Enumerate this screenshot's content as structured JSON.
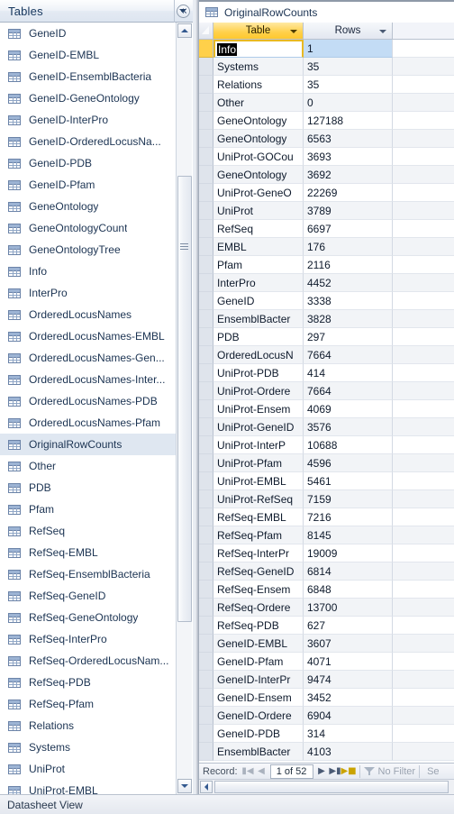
{
  "nav_pane": {
    "title": "Tables",
    "menu_icon": "chevron-down-circle-icon",
    "collapse_icon": "double-chevron-left-icon",
    "items": [
      {
        "label": "GeneID",
        "selected": false
      },
      {
        "label": "GeneID-EMBL",
        "selected": false
      },
      {
        "label": "GeneID-EnsemblBacteria",
        "selected": false
      },
      {
        "label": "GeneID-GeneOntology",
        "selected": false
      },
      {
        "label": "GeneID-InterPro",
        "selected": false
      },
      {
        "label": "GeneID-OrderedLocusNa...",
        "selected": false
      },
      {
        "label": "GeneID-PDB",
        "selected": false
      },
      {
        "label": "GeneID-Pfam",
        "selected": false
      },
      {
        "label": "GeneOntology",
        "selected": false
      },
      {
        "label": "GeneOntologyCount",
        "selected": false
      },
      {
        "label": "GeneOntologyTree",
        "selected": false
      },
      {
        "label": "Info",
        "selected": false
      },
      {
        "label": "InterPro",
        "selected": false
      },
      {
        "label": "OrderedLocusNames",
        "selected": false
      },
      {
        "label": "OrderedLocusNames-EMBL",
        "selected": false
      },
      {
        "label": "OrderedLocusNames-Gen...",
        "selected": false
      },
      {
        "label": "OrderedLocusNames-Inter...",
        "selected": false
      },
      {
        "label": "OrderedLocusNames-PDB",
        "selected": false
      },
      {
        "label": "OrderedLocusNames-Pfam",
        "selected": false
      },
      {
        "label": "OriginalRowCounts",
        "selected": true
      },
      {
        "label": "Other",
        "selected": false
      },
      {
        "label": "PDB",
        "selected": false
      },
      {
        "label": "Pfam",
        "selected": false
      },
      {
        "label": "RefSeq",
        "selected": false
      },
      {
        "label": "RefSeq-EMBL",
        "selected": false
      },
      {
        "label": "RefSeq-EnsemblBacteria",
        "selected": false
      },
      {
        "label": "RefSeq-GeneID",
        "selected": false
      },
      {
        "label": "RefSeq-GeneOntology",
        "selected": false
      },
      {
        "label": "RefSeq-InterPro",
        "selected": false
      },
      {
        "label": "RefSeq-OrderedLocusNam...",
        "selected": false
      },
      {
        "label": "RefSeq-PDB",
        "selected": false
      },
      {
        "label": "RefSeq-Pfam",
        "selected": false
      },
      {
        "label": "Relations",
        "selected": false
      },
      {
        "label": "Systems",
        "selected": false
      },
      {
        "label": "UniProt",
        "selected": false
      },
      {
        "label": "UniProt-EMBL",
        "selected": false
      }
    ]
  },
  "document": {
    "tab_label": "OriginalRowCounts",
    "tab_icon": "table-icon"
  },
  "grid": {
    "columns": [
      {
        "label": "Table",
        "active": true,
        "width": 100,
        "dropdown_icon": "chevron-down-icon"
      },
      {
        "label": "Rows",
        "active": false,
        "width": 100,
        "dropdown_icon": "chevron-down-icon"
      }
    ],
    "editing_cell": {
      "row": 0,
      "column": 0,
      "value": "Info",
      "selected_text": true
    },
    "rows": [
      {
        "table": "Info",
        "rows": "1"
      },
      {
        "table": "Systems",
        "rows": "35"
      },
      {
        "table": "Relations",
        "rows": "35"
      },
      {
        "table": "Other",
        "rows": "0"
      },
      {
        "table": "GeneOntology",
        "rows": "127188"
      },
      {
        "table": "GeneOntology",
        "rows": "6563"
      },
      {
        "table": "UniProt-GOCou",
        "rows": "3693"
      },
      {
        "table": "GeneOntology",
        "rows": "3692"
      },
      {
        "table": "UniProt-GeneO",
        "rows": "22269"
      },
      {
        "table": "UniProt",
        "rows": "3789"
      },
      {
        "table": "RefSeq",
        "rows": "6697"
      },
      {
        "table": "EMBL",
        "rows": "176"
      },
      {
        "table": "Pfam",
        "rows": "2116"
      },
      {
        "table": "InterPro",
        "rows": "4452"
      },
      {
        "table": "GeneID",
        "rows": "3338"
      },
      {
        "table": "EnsemblBacter",
        "rows": "3828"
      },
      {
        "table": "PDB",
        "rows": "297"
      },
      {
        "table": "OrderedLocusN",
        "rows": "7664"
      },
      {
        "table": "UniProt-PDB",
        "rows": "414"
      },
      {
        "table": "UniProt-Ordere",
        "rows": "7664"
      },
      {
        "table": "UniProt-Ensem",
        "rows": "4069"
      },
      {
        "table": "UniProt-GeneID",
        "rows": "3576"
      },
      {
        "table": "UniProt-InterP",
        "rows": "10688"
      },
      {
        "table": "UniProt-Pfam",
        "rows": "4596"
      },
      {
        "table": "UniProt-EMBL",
        "rows": "5461"
      },
      {
        "table": "UniProt-RefSeq",
        "rows": "7159"
      },
      {
        "table": "RefSeq-EMBL",
        "rows": "7216"
      },
      {
        "table": "RefSeq-Pfam",
        "rows": "8145"
      },
      {
        "table": "RefSeq-InterPr",
        "rows": "19009"
      },
      {
        "table": "RefSeq-GeneID",
        "rows": "6814"
      },
      {
        "table": "RefSeq-Ensem",
        "rows": "6848"
      },
      {
        "table": "RefSeq-Ordere",
        "rows": "13700"
      },
      {
        "table": "RefSeq-PDB",
        "rows": "627"
      },
      {
        "table": "GeneID-EMBL",
        "rows": "3607"
      },
      {
        "table": "GeneID-Pfam",
        "rows": "4071"
      },
      {
        "table": "GeneID-InterPr",
        "rows": "9474"
      },
      {
        "table": "GeneID-Ensem",
        "rows": "3452"
      },
      {
        "table": "GeneID-Ordere",
        "rows": "6904"
      },
      {
        "table": "GeneID-PDB",
        "rows": "314"
      },
      {
        "table": "EnsemblBacter",
        "rows": "4103"
      }
    ]
  },
  "record_nav": {
    "label": "Record:",
    "first_icon": "first-record-icon",
    "prev_icon": "previous-record-icon",
    "position": "1 of 52",
    "next_icon": "next-record-icon",
    "last_icon": "last-record-icon",
    "new_icon": "new-record-icon",
    "filter_icon": "funnel-icon",
    "filter_label": "No Filter",
    "search_label": "Se"
  },
  "scrollbars": {
    "nav_up_icon": "triangle-up-icon",
    "nav_down_icon": "triangle-down-icon",
    "h_left_icon": "triangle-left-icon"
  },
  "status_bar": {
    "text": "Datasheet View"
  },
  "colors": {
    "accent_gold": "#ffd04a",
    "selection_blue": "#c3dcf5",
    "nav_title": "#17375e",
    "nav_selected": "#dfe7f1"
  }
}
